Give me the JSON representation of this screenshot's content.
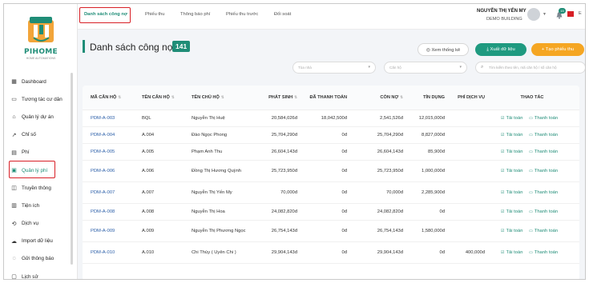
{
  "app": {
    "logo_text": "PIHOME",
    "logo_sub": "HOME AUTOMATIONS",
    "brand_color": "#1f8d77",
    "highlight_color": "#d81f26"
  },
  "sidebar": {
    "items": [
      {
        "label": "Dashboard",
        "icon": "grid-icon",
        "glyph": "▦"
      },
      {
        "label": "Tương tác cư dân",
        "icon": "chat-icon",
        "glyph": "▭"
      },
      {
        "label": "Quản lý dự án",
        "icon": "building-icon",
        "glyph": "⌂"
      },
      {
        "label": "Chỉ số",
        "icon": "chart-icon",
        "glyph": "↗"
      },
      {
        "label": "Phí",
        "icon": "fee-icon",
        "glyph": "▤"
      },
      {
        "label": "Quản lý phí",
        "icon": "fee-manage-icon",
        "glyph": "▣"
      },
      {
        "label": "Truyền thông",
        "icon": "media-icon",
        "glyph": "◫"
      },
      {
        "label": "Tiện ích",
        "icon": "utility-icon",
        "glyph": "▥"
      },
      {
        "label": "Dịch vụ",
        "icon": "service-icon",
        "glyph": "⟲"
      },
      {
        "label": "Import dữ liệu",
        "icon": "import-icon",
        "glyph": "☁"
      },
      {
        "label": "Gửi thông báo",
        "icon": "notify-icon",
        "glyph": "◌"
      },
      {
        "label": "Lịch sử",
        "icon": "history-icon",
        "glyph": "▢"
      }
    ]
  },
  "topbar": {
    "tabs": [
      "Danh sách công nợ",
      "Phiếu thu",
      "Thông báo phí",
      "Phiếu thu trước",
      "Đối soát"
    ],
    "user_name": "NGUYỄN THỊ YẾN MY",
    "user_building": "DEMO BUILDING",
    "notif_count": "15",
    "lang": "E"
  },
  "page": {
    "title": "Danh sách công nợ",
    "count": "141",
    "btn_view": "Xem thống kê",
    "btn_export": "Xuất dữ liệu",
    "btn_create": "Tạo phiếu thu",
    "filter_building": "Tòa nhà",
    "filter_apartment": "Căn hộ",
    "search_placeholder": "Tìm kiếm theo tên, mã căn hộ / số căn hộ"
  },
  "table": {
    "headers": [
      "MÃ CĂN HỘ",
      "TÊN CĂN HỘ",
      "TÊN CHỦ HỘ",
      "PHÁT SINH",
      "ĐÃ THANH TOÁN",
      "CÒN NỢ",
      "TÍN DỤNG",
      "PHÍ DỊCH VỤ",
      "THAO TÁC"
    ],
    "action_download": "Tải toàn",
    "action_pay": "Thanh toán",
    "rows": [
      {
        "code": "PDM-A-003",
        "apt": "BQL",
        "owner": "Nguyễn Thị Huệ",
        "arise": "20,584,026đ",
        "paid": "18,042,500đ",
        "debt": "2,541,526đ",
        "credit": "12,015,000đ",
        "service": ""
      },
      {
        "code": "PDM-A-004",
        "apt": "A.004",
        "owner": "Đào Ngọc Phong",
        "arise": "25,704,290đ",
        "paid": "0đ",
        "debt": "25,704,290đ",
        "credit": "8,827,000đ",
        "service": ""
      },
      {
        "code": "PDM-A-005",
        "apt": "A.005",
        "owner": "Phạm Anh Thu",
        "arise": "26,604,143đ",
        "paid": "0đ",
        "debt": "26,604,143đ",
        "credit": "85,900đ",
        "service": ""
      },
      {
        "code": "PDM-A-006",
        "apt": "A.006",
        "owner": "Đồng Thị Hương Quỳnh",
        "arise": "25,723,950đ",
        "paid": "0đ",
        "debt": "25,723,950đ",
        "credit": "1,000,000đ",
        "service": ""
      },
      {
        "code": "PDM-A-007",
        "apt": "A.007",
        "owner": "Nguyễn Thị Yến My",
        "arise": "70,000đ",
        "paid": "0đ",
        "debt": "70,000đ",
        "credit": "2,285,900đ",
        "service": ""
      },
      {
        "code": "PDM-A-008",
        "apt": "A.008",
        "owner": "Nguyễn Thị Hoa",
        "arise": "24,082,820đ",
        "paid": "0đ",
        "debt": "24,082,820đ",
        "credit": "0đ",
        "service": ""
      },
      {
        "code": "PDM-A-009",
        "apt": "A.009",
        "owner": "Nguyễn Thị Phương Ngọc",
        "arise": "26,754,143đ",
        "paid": "0đ",
        "debt": "26,754,143đ",
        "credit": "1,580,000đ",
        "service": ""
      },
      {
        "code": "PDM-A-010",
        "apt": "A.010",
        "owner": "Chi Thùy ( Uyên Chi )",
        "arise": "29,904,143đ",
        "paid": "0đ",
        "debt": "29,904,143đ",
        "credit": "0đ",
        "service": "400,000đ"
      }
    ]
  }
}
